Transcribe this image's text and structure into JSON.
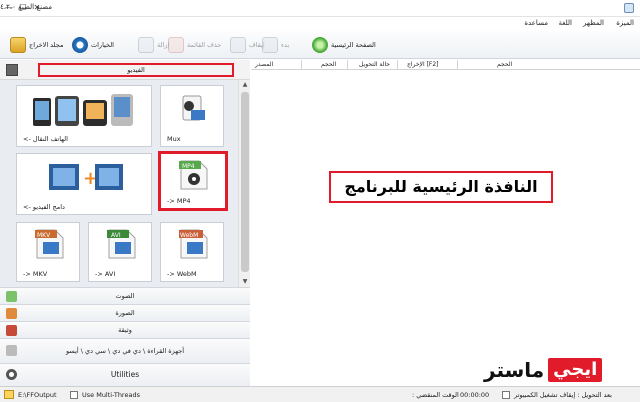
{
  "window": {
    "title": "مصنع الصيغ ٤.٢.٠",
    "min": "—",
    "max": "☐",
    "close": "✕"
  },
  "menu": [
    "الميزة",
    "المظهر",
    "اللغة",
    "مساعدة"
  ],
  "toolbar": {
    "output_folder": "مجلد الاخراج",
    "options": "الخيارات",
    "remove": "إزالة",
    "clear_list": "حذف القائمة",
    "stop": "إيقاف",
    "start": "بدء",
    "home": "الصفحة الرئيسية"
  },
  "left": {
    "header": "الفيديو",
    "tiles": [
      {
        "label": "الهاتف النقال ->",
        "icon": "mobile-devices-icon"
      },
      {
        "label": "Mux",
        "icon": "mux-icon"
      },
      {
        "label": "دامج الفيديو ->",
        "icon": "video-joiner-icon"
      },
      {
        "label": "-> MP4",
        "icon": "mp4-file-icon",
        "badge": "MP4"
      },
      {
        "label": "-> MKV",
        "icon": "mkv-file-icon",
        "badge": "MKV"
      },
      {
        "label": "-> AVI",
        "icon": "avi-file-icon",
        "badge": "AVI"
      },
      {
        "label": "-> WebM",
        "icon": "webm-file-icon",
        "badge": "WebM"
      }
    ],
    "categories": [
      "الصوت",
      "الصورة",
      "وثيقة",
      "أجهزة القراءة \\ دي في دي \\ سي دي \\ أيسو",
      "Utilities"
    ]
  },
  "columns": [
    "المصدر",
    "الحجم",
    "حالة التحويل",
    "الإخراج [F2]",
    "الحجم"
  ],
  "main_label": "النافذة الرئيسية للبرنامج",
  "watermark": {
    "a": "ايجي",
    "b": "ماستر"
  },
  "status": {
    "output": "E:\\FFOutput",
    "multithread": "Use Multi-Threads",
    "elapsed_label": "الوقت المنقضي :",
    "elapsed": "00:00:00",
    "after": "بعد التحويل : إيقاف تشغيل الكمبيوتر"
  },
  "colors": {
    "accent_red": "#e21b2a",
    "panel_bg": "#e9edf2"
  }
}
